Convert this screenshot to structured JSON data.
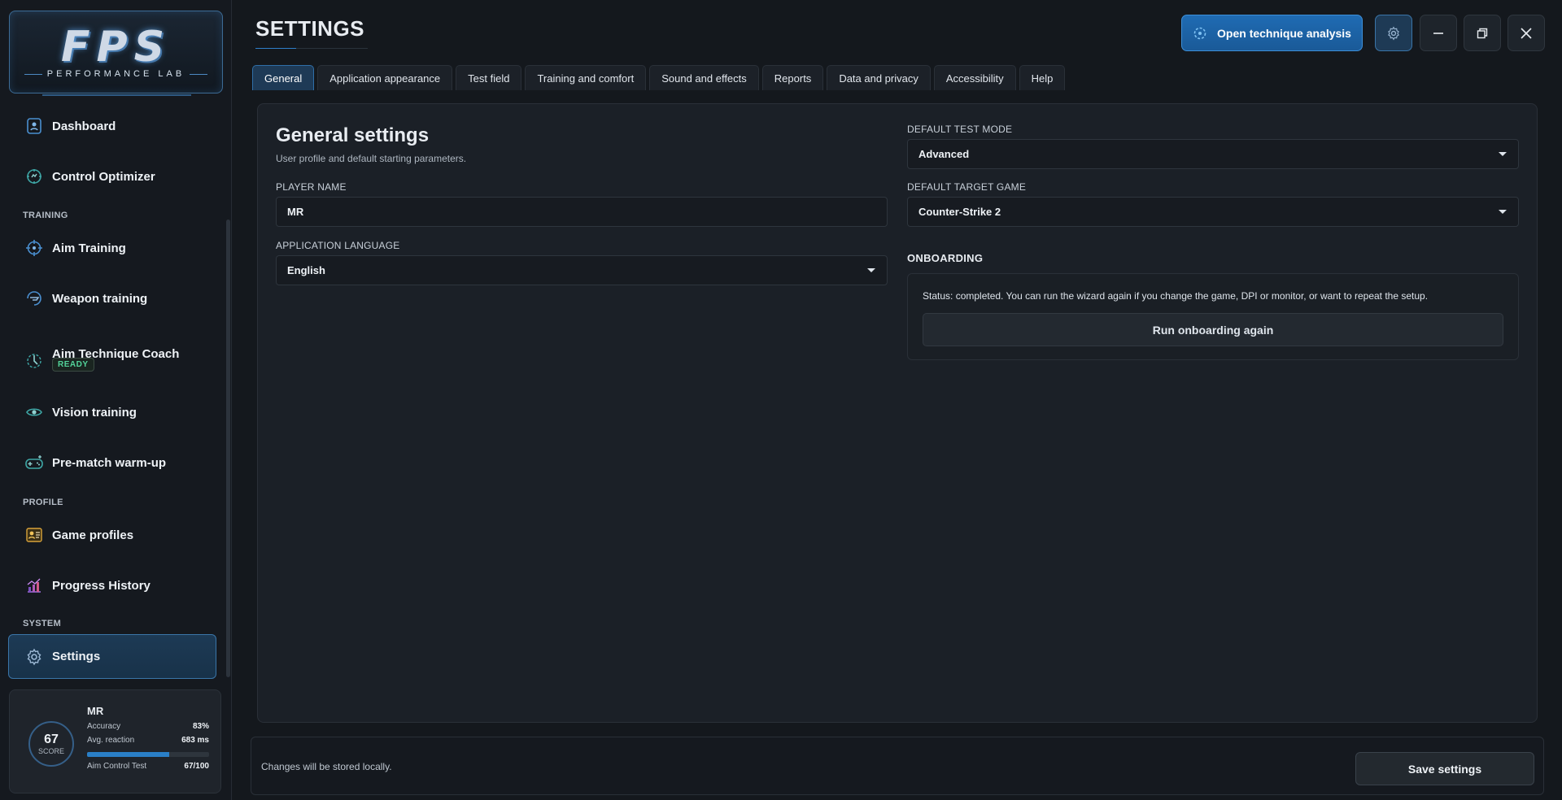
{
  "brand": {
    "logo_text": "FPS",
    "logo_subtitle": "PERFORMANCE LAB"
  },
  "sidebar": {
    "items": [
      {
        "label": "Dashboard",
        "icon": "dashboard-icon"
      },
      {
        "label": "Control Optimizer",
        "icon": "optimizer-icon"
      },
      {
        "label": "Aim Training",
        "icon": "crosshair-icon"
      },
      {
        "label": "Weapon training",
        "icon": "weapon-icon"
      },
      {
        "label": "Aim Technique Coach",
        "icon": "coach-icon",
        "badge": "READY"
      },
      {
        "label": "Vision training",
        "icon": "eye-icon"
      },
      {
        "label": "Pre-match warm-up",
        "icon": "gamepad-icon"
      },
      {
        "label": "Game profiles",
        "icon": "profile-card-icon"
      },
      {
        "label": "Progress History",
        "icon": "chart-icon"
      },
      {
        "label": "Settings",
        "icon": "gear-icon",
        "active": true
      }
    ],
    "sections": {
      "training": "TRAINING",
      "profile": "PROFILE",
      "system": "SYSTEM"
    }
  },
  "profile_card": {
    "score": "67",
    "score_label": "SCORE",
    "name": "MR",
    "accuracy_label": "Accuracy",
    "accuracy_value": "83%",
    "reaction_label": "Avg. reaction",
    "reaction_value": "683 ms",
    "test_label": "Aim Control Test",
    "test_value": "67/100",
    "test_progress": 0.67
  },
  "header": {
    "title": "SETTINGS",
    "primary_button": "Open technique analysis"
  },
  "tabs": [
    {
      "label": "General",
      "active": true
    },
    {
      "label": "Application appearance"
    },
    {
      "label": "Test field"
    },
    {
      "label": "Training and comfort"
    },
    {
      "label": "Sound and effects"
    },
    {
      "label": "Reports"
    },
    {
      "label": "Data and privacy"
    },
    {
      "label": "Accessibility"
    },
    {
      "label": "Help"
    }
  ],
  "general": {
    "title": "General settings",
    "subtitle": "User profile and default starting parameters.",
    "player_name_label": "PLAYER NAME",
    "player_name_value": "MR",
    "language_label": "APPLICATION LANGUAGE",
    "language_value": "English",
    "test_mode_label": "DEFAULT TEST MODE",
    "test_mode_value": "Advanced",
    "target_game_label": "DEFAULT TARGET GAME",
    "target_game_value": "Counter-Strike 2",
    "onboarding_title": "ONBOARDING",
    "onboarding_status": "Status: completed. You can run the wizard again if you change the game, DPI or monitor, or want to repeat the setup.",
    "onboarding_button": "Run onboarding again"
  },
  "footer": {
    "note": "Changes will be stored locally.",
    "save_button": "Save settings"
  },
  "colors": {
    "accent": "#2a7fc7",
    "ready": "#53d49a",
    "background": "#14181d"
  }
}
